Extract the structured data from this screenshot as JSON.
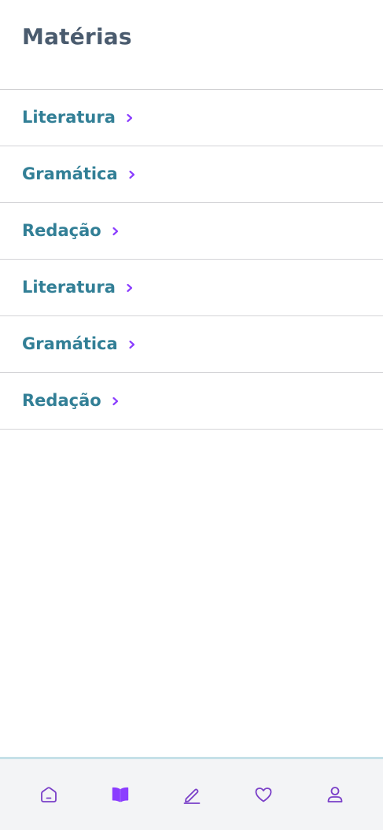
{
  "header": {
    "title": "Matérias"
  },
  "subjects": [
    {
      "label": "Literatura",
      "icon": "chevron-right-icon"
    },
    {
      "label": "Gramática",
      "icon": "chevron-right-icon"
    },
    {
      "label": "Redação",
      "icon": "chevron-right-icon"
    },
    {
      "label": "Literatura",
      "icon": "chevron-right-icon"
    },
    {
      "label": "Gramática",
      "icon": "chevron-right-icon"
    },
    {
      "label": "Redação",
      "icon": "chevron-right-icon"
    }
  ],
  "tab_bar": {
    "tabs": [
      {
        "icon": "home-icon",
        "active": false
      },
      {
        "icon": "book-icon",
        "active": true
      },
      {
        "icon": "pencil-icon",
        "active": false
      },
      {
        "icon": "heart-icon",
        "active": false
      },
      {
        "icon": "user-icon",
        "active": false
      }
    ]
  },
  "colors": {
    "title": "#4a5b6e",
    "subject_text": "#327f96",
    "accent": "#8b3dff",
    "tab_icon": "#7a3fc8",
    "tab_bar_bg": "#f3f4f6",
    "tab_bar_border": "#c5e0e8"
  }
}
